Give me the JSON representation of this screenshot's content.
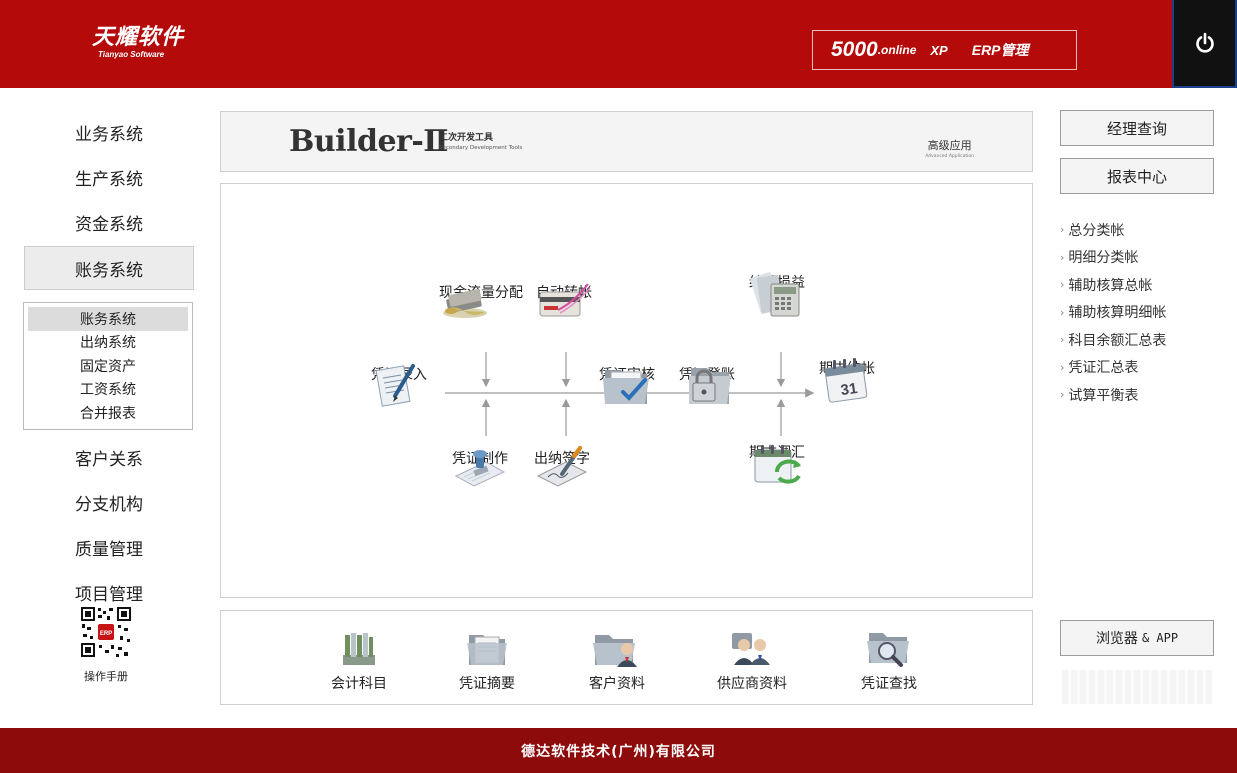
{
  "header": {
    "logo_cn": "天耀软件",
    "logo_en": "Tianyao Software",
    "product_num": "5000",
    "product_online": ".online",
    "product_xp": "XP",
    "product_erp": "ERP管理",
    "power_icon": "power-icon"
  },
  "left_nav": {
    "items_top": [
      "业务系统",
      "生产系统",
      "资金系统",
      "账务系统"
    ],
    "active": "账务系统",
    "sub_items": [
      "账务系统",
      "出纳系统",
      "固定资产",
      "工资系统",
      "合并报表"
    ],
    "sub_selected": "账务系统",
    "items_bottom": [
      "客户关系",
      "分支机构",
      "质量管理",
      "项目管理"
    ],
    "qr_label": "操作手册"
  },
  "banner": {
    "title": "Builder-Ⅱ",
    "sub_cn": "二次开发工具",
    "sub_en": "Secondary Development Tools",
    "adv_cn": "高级应用",
    "adv_en": "Advanced Application"
  },
  "flow": {
    "cash_flow": "现金流量分配",
    "auto_transfer": "自动转帐",
    "transfer_pl": "结转损益",
    "voucher_entry": "凭证录入",
    "voucher_audit": "凭证审核",
    "voucher_post": "凭证登账",
    "period_close": "期末结帐",
    "voucher_make": "凭证制作",
    "cashier_sign": "出纳签字",
    "period_fx": "期末调汇"
  },
  "bottom_tools": [
    "会计科目",
    "凭证摘要",
    "客户资料",
    "供应商资料",
    "凭证查找"
  ],
  "right_panel": {
    "btn_manager": "经理查询",
    "btn_report": "报表中心",
    "links": [
      "总分类帐",
      "明细分类帐",
      "辅助核算总帐",
      "辅助核算明细帐",
      "科目余额汇总表",
      "凭证汇总表",
      "试算平衡表"
    ],
    "btn_app": "浏览器",
    "btn_app_suffix": "& APP"
  },
  "footer": {
    "company": "德达软件技术(广州)有限公司"
  }
}
